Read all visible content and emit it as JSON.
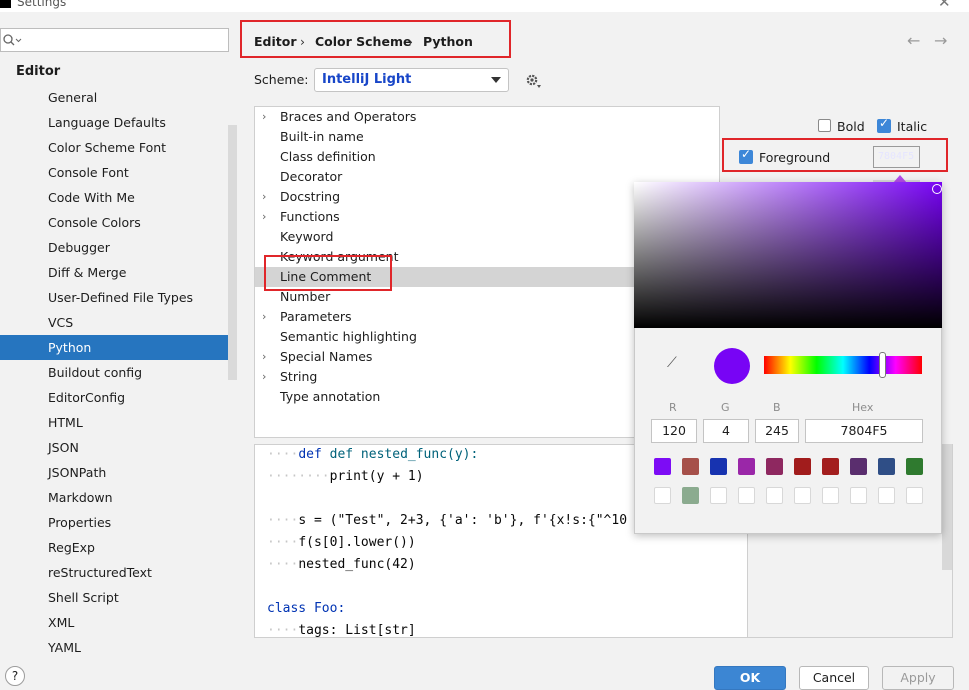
{
  "window": {
    "title": "Settings"
  },
  "sidebar": {
    "search_placeholder": "",
    "header": "Editor",
    "items": [
      {
        "label": "General"
      },
      {
        "label": "Language Defaults"
      },
      {
        "label": "Color Scheme Font"
      },
      {
        "label": "Console Font"
      },
      {
        "label": "Code With Me"
      },
      {
        "label": "Console Colors"
      },
      {
        "label": "Debugger"
      },
      {
        "label": "Diff & Merge"
      },
      {
        "label": "User-Defined File Types"
      },
      {
        "label": "VCS"
      },
      {
        "label": "Python"
      },
      {
        "label": "Buildout config"
      },
      {
        "label": "EditorConfig"
      },
      {
        "label": "HTML"
      },
      {
        "label": "JSON"
      },
      {
        "label": "JSONPath"
      },
      {
        "label": "Markdown"
      },
      {
        "label": "Properties"
      },
      {
        "label": "RegExp"
      },
      {
        "label": "reStructuredText"
      },
      {
        "label": "Shell Script"
      },
      {
        "label": "XML"
      },
      {
        "label": "YAML"
      }
    ],
    "selected": "Python"
  },
  "breadcrumb": {
    "items": [
      "Editor",
      "Color Scheme",
      "Python"
    ],
    "separator": "›"
  },
  "scheme": {
    "label": "Scheme:",
    "value": "IntelliJ Light"
  },
  "tree": {
    "items": [
      {
        "label": "Braces and Operators",
        "expandable": true
      },
      {
        "label": "Built-in name",
        "expandable": false
      },
      {
        "label": "Class definition",
        "expandable": false
      },
      {
        "label": "Decorator",
        "expandable": false
      },
      {
        "label": "Docstring",
        "expandable": true
      },
      {
        "label": "Functions",
        "expandable": true
      },
      {
        "label": "Keyword",
        "expandable": false
      },
      {
        "label": "Keyword argument",
        "expandable": false
      },
      {
        "label": "Line Comment",
        "expandable": false
      },
      {
        "label": "Number",
        "expandable": false
      },
      {
        "label": "Parameters",
        "expandable": true
      },
      {
        "label": "Semantic highlighting",
        "expandable": false
      },
      {
        "label": "Special Names",
        "expandable": true
      },
      {
        "label": "String",
        "expandable": true
      },
      {
        "label": "Type annotation",
        "expandable": false
      }
    ],
    "selected": "Line Comment"
  },
  "options": {
    "bold_label": "Bold",
    "bold_checked": false,
    "italic_label": "Italic",
    "italic_checked": true,
    "foreground_label": "Foreground",
    "foreground_checked": true,
    "foreground_hex": "7804F5"
  },
  "picker": {
    "r_label": "R",
    "g_label": "G",
    "b_label": "B",
    "hex_label": "Hex",
    "r": "120",
    "g": "4",
    "b": "245",
    "hex": "7804F5",
    "current_color": "#7804f5",
    "recent_colors": [
      "#7d0cf5",
      "#a6504a",
      "#1733b0",
      "#9a27a8",
      "#8e2860",
      "#a11c1c",
      "#a31e1e",
      "#5a2e6e",
      "#2f4e86",
      "#2f7a2f"
    ],
    "saved_colors": [
      "",
      "#8bab8f",
      "",
      "",
      "",
      "",
      "",
      "",
      "",
      ""
    ]
  },
  "code": {
    "lines": [
      "def nested_func(y):",
      "print(y + 1)",
      "",
      "s = (\"Test\", 2+3, {'a': 'b'}, f'{x!s:{\"^10",
      "f(s[0].lower())",
      "nested_func(42)",
      "",
      "class Foo:",
      "tags: List[str]"
    ]
  },
  "buttons": {
    "ok": "OK",
    "cancel": "Cancel",
    "apply": "Apply",
    "help": "?"
  },
  "nav": {
    "back": "←",
    "forward": "→"
  },
  "colors": {
    "accent": "#2675bf",
    "highlight_box": "#e0262a",
    "selected_color": "#7804f5"
  }
}
